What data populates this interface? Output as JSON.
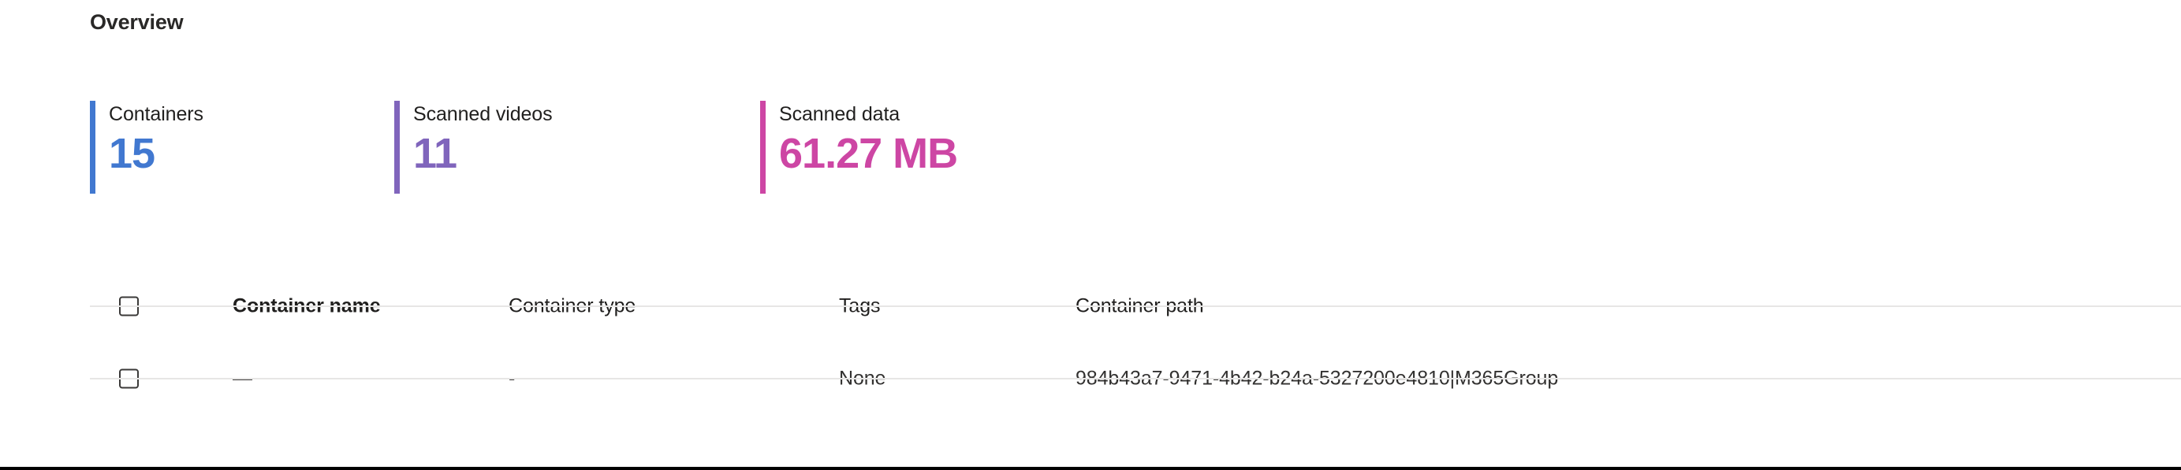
{
  "section": {
    "title": "Overview"
  },
  "metrics": [
    {
      "label": "Containers",
      "value": "15",
      "color": "#4178d0",
      "bar_name": "metric-accent-bar-containers"
    },
    {
      "label": "Scanned videos",
      "value": "11",
      "color": "#8065bc",
      "bar_name": "metric-accent-bar-scanned-videos"
    },
    {
      "label": "Scanned data",
      "value": "61.27 MB",
      "color": "#cd46a4",
      "bar_name": "metric-accent-bar-scanned-data"
    }
  ],
  "table": {
    "select_all_checkbox": {
      "checked": false,
      "icon": "checkbox-unchecked-icon"
    },
    "columns": [
      {
        "label": "Container name",
        "sorted": true
      },
      {
        "label": "Container type",
        "sorted": false
      },
      {
        "label": "Tags",
        "sorted": false
      },
      {
        "label": "Container path",
        "sorted": false
      }
    ],
    "rows": [
      {
        "selected": false,
        "container_name": "—",
        "container_type": "-",
        "tags": "None",
        "container_path": "984b43a7-9471-4b42-b24a-5327200e4810|M365Group"
      }
    ]
  }
}
